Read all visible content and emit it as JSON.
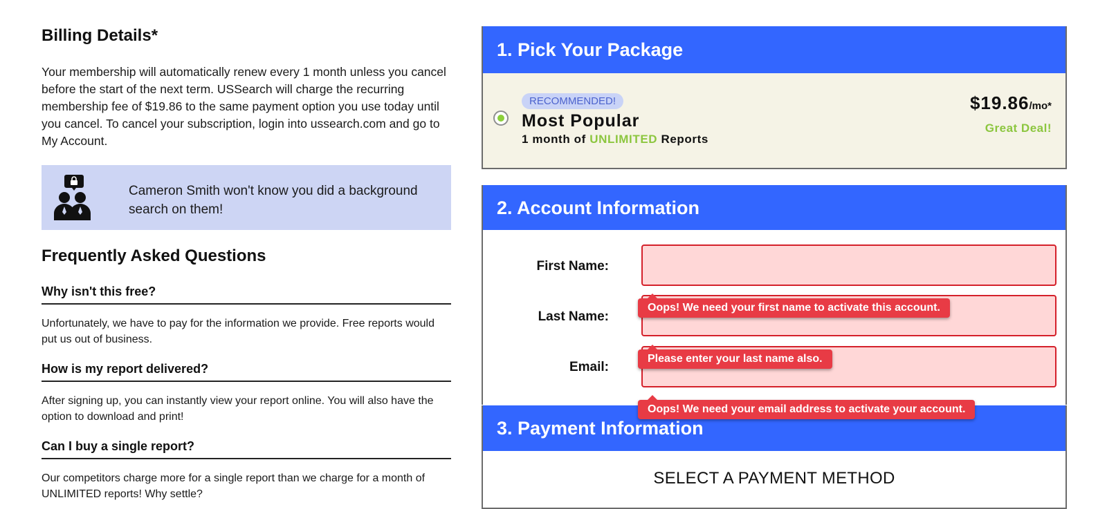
{
  "billing": {
    "title": "Billing Details*",
    "text": "Your membership will automatically renew every 1 month unless you cancel before the start of the next term. USSearch will charge the recurring membership fee of $19.86 to the same payment option you use today until you cancel. To cancel your subscription, login into ussearch.com and go to My Account."
  },
  "privacy": {
    "icon": "anonymous-people-lock-icon",
    "text": "Cameron Smith won't know you did a background search on them!"
  },
  "faq": {
    "title": "Frequently Asked Questions",
    "items": [
      {
        "question": "Why isn't this free?",
        "answer": "Unfortunately, we have to pay for the information we provide. Free reports would put us out of business."
      },
      {
        "question": "How is my report delivered?",
        "answer": "After signing up, you can instantly view your report online. You will also have the option to download and print!"
      },
      {
        "question": "Can I buy a single report?",
        "answer": "Our competitors charge more for a single report than we charge for a month of UNLIMITED reports! Why settle?"
      }
    ]
  },
  "package": {
    "header": "1. Pick Your Package",
    "badge": "RECOMMENDED!",
    "name": "Most Popular",
    "desc_prefix": "1 month of ",
    "desc_accent": "UNLIMITED",
    "desc_suffix": " Reports",
    "price": "$19.86",
    "price_unit": "/mo*",
    "deal": "Great Deal!",
    "selected": true
  },
  "account": {
    "header": "2. Account Information",
    "fields": {
      "first_name": {
        "label": "First Name:",
        "value": "",
        "error": "Oops! We need your first name to activate this account."
      },
      "last_name": {
        "label": "Last Name:",
        "value": "",
        "error": "Please enter your last name also."
      },
      "email": {
        "label": "Email:",
        "value": "",
        "error": "Oops! We need your email address to activate your account."
      }
    }
  },
  "payment": {
    "header": "3. Payment Information",
    "select_label": "SELECT A PAYMENT METHOD"
  },
  "colors": {
    "header_blue": "#3366ff",
    "accent_green": "#8cc63f",
    "error_red": "#e83b45",
    "error_bg": "#ffd7d7",
    "privacy_bg": "#cdd5f4",
    "package_bg": "#f5f3e6"
  }
}
